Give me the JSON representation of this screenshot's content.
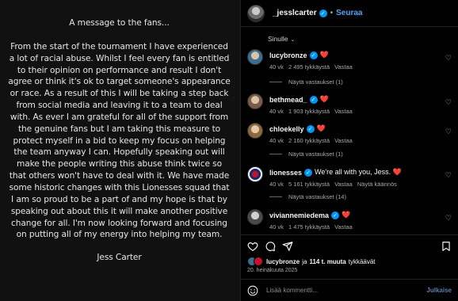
{
  "post_image": {
    "heading": "A message to the fans...",
    "body": "From the start of the tournament I have experienced a lot of racial abuse. Whilst I feel every fan is entitled to their opinion on performance and result I don't agree or think it's ok to target someone's appearance or race. As a result of this I will be taking a step back from social media and leaving it to a team to deal with. As ever I am grateful for all of the support from the genuine fans but I am taking this measure to protect myself in a bid to keep my focus on helping the team anyway I can. Hopefully speaking out will make the people writing this abuse think twice so that others won't have to deal with it. We have made some historic changes with this Lionesses squad that I am so proud to be a part of and my hope is that by speaking out about this it will make another positive change for all. I'm now looking forward and focusing on putting all of my energy into helping my team.",
    "signature": "Jess Carter"
  },
  "header": {
    "username": "_jesslcarter",
    "separator": "•",
    "follow_label": "Seuraa"
  },
  "comments_sort": {
    "label": "Sinulle",
    "chevron": "⌄"
  },
  "comments": [
    {
      "username": "lucybronze",
      "text": "❤️",
      "time": "40 vk",
      "likes": "2 495 tykkäystä",
      "reply": "Vastaa",
      "replies_label": "Näytä vastaukset (1)",
      "translate": "",
      "avatar_color": "#3b6e8f"
    },
    {
      "username": "bethmead_",
      "text": "❤️",
      "time": "40 vk",
      "likes": "1 903 tykkäystä",
      "reply": "Vastaa",
      "replies_label": "",
      "translate": "",
      "avatar_color": "#7a5a4a"
    },
    {
      "username": "chloekelly",
      "text": "❤️",
      "time": "40 vk",
      "likes": "2 160 tykkäystä",
      "reply": "Vastaa",
      "replies_label": "Näytä vastaukset (1)",
      "translate": "",
      "avatar_color": "#8a6a3a"
    },
    {
      "username": "lionesses",
      "text": "We're all with you, Jess. ❤️",
      "time": "40 vk",
      "likes": "5 161 tykkäystä",
      "reply": "Vastaa",
      "replies_label": "Näytä vastaukset (14)",
      "translate": "Näytä käännös",
      "avatar_color": "#f5f5f5"
    },
    {
      "username": "viviannemiedema",
      "text": "❤️",
      "time": "40 vk",
      "likes": "1 475 tykkäystä",
      "reply": "Vastaa",
      "replies_label": "",
      "translate": "",
      "avatar_color": "#4a4a4a"
    }
  ],
  "likes_summary": {
    "first_liker": "lucybronze",
    "connector": "ja",
    "others": "114 t. muuta",
    "suffix": "tykkäävät"
  },
  "post_date": "20. heinäkuuta 2025",
  "comment_input": {
    "placeholder": "Lisää kommentti...",
    "post_label": "Julkaise"
  },
  "colors": {
    "accent": "#0095f6",
    "heart": "#ff2d55",
    "background": "#000000"
  },
  "icons": [
    "like-heart-icon",
    "comment-icon",
    "share-icon",
    "save-icon",
    "emoji-icon",
    "verified-icon"
  ]
}
